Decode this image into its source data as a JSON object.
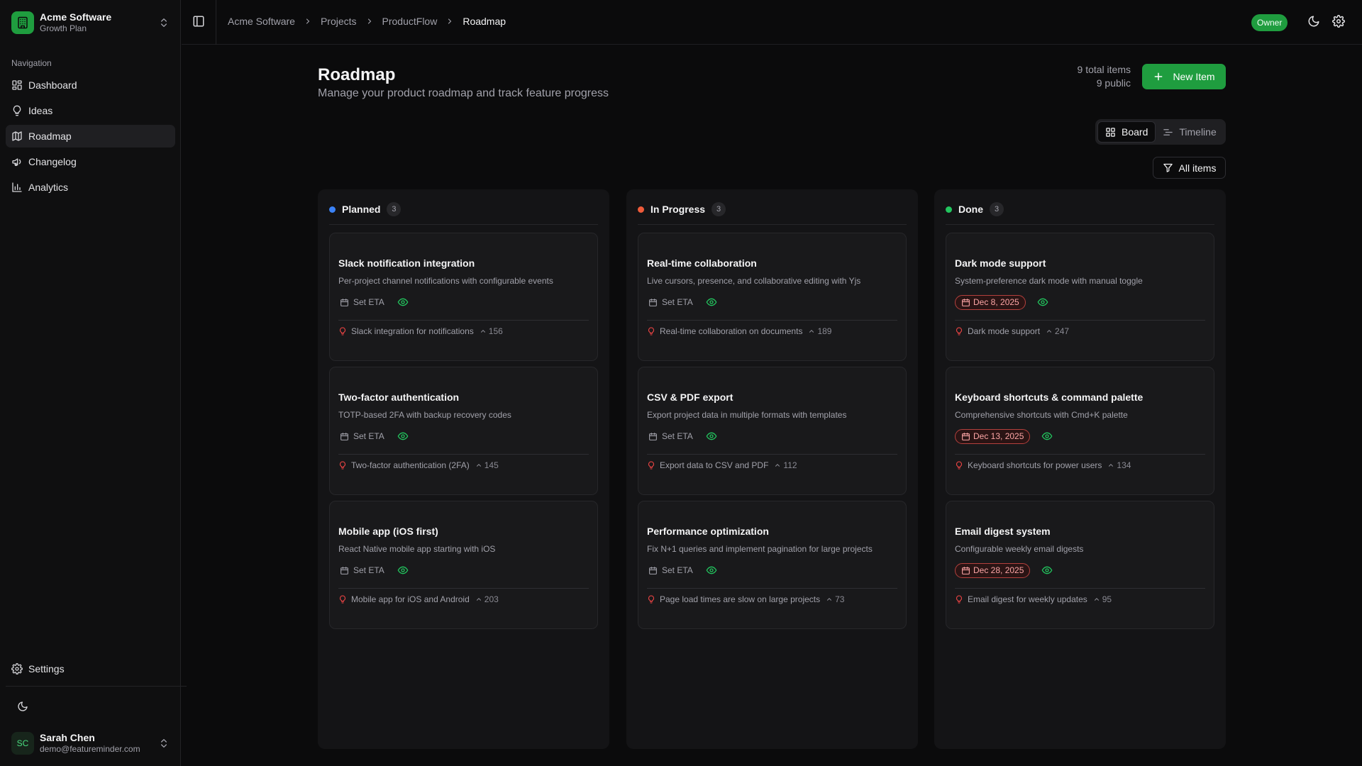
{
  "workspace": {
    "name": "Acme Software",
    "plan": "Growth Plan"
  },
  "nav": {
    "label": "Navigation",
    "items": [
      {
        "label": "Dashboard",
        "icon": "dashboard-icon"
      },
      {
        "label": "Ideas",
        "icon": "lightbulb-icon"
      },
      {
        "label": "Roadmap",
        "icon": "map-icon",
        "active": true
      },
      {
        "label": "Changelog",
        "icon": "megaphone-icon"
      },
      {
        "label": "Analytics",
        "icon": "bar-chart-icon"
      }
    ],
    "settings": "Settings"
  },
  "user": {
    "initials": "SC",
    "name": "Sarah Chen",
    "email": "demo@featureminder.com"
  },
  "breadcrumb": [
    "Acme Software",
    "Projects",
    "ProductFlow",
    "Roadmap"
  ],
  "header": {
    "role_badge": "Owner"
  },
  "page": {
    "title": "Roadmap",
    "subtitle": "Manage your product roadmap and track feature progress",
    "total_items": "9 total items",
    "public_items": "9 public",
    "new_button": "New Item"
  },
  "view_toggle": {
    "board": "Board",
    "timeline": "Timeline",
    "active": "board"
  },
  "filter": {
    "label": "All items"
  },
  "colors": {
    "accent": "#1f9d3f",
    "planned": "#3b82f6",
    "in_progress": "#ef5b3a",
    "done": "#22c55e",
    "eta_overdue": "#ef4444"
  },
  "columns": [
    {
      "title": "Planned",
      "count": "3",
      "status": "planned",
      "cards": [
        {
          "title": "Slack notification integration",
          "description": "Per-project channel notifications with configurable events",
          "eta": "Set ETA",
          "eta_set": false,
          "idea": "Slack integration for notifications",
          "votes": "156"
        },
        {
          "title": "Two-factor authentication",
          "description": "TOTP-based 2FA with backup recovery codes",
          "eta": "Set ETA",
          "eta_set": false,
          "idea": "Two-factor authentication (2FA)",
          "votes": "145"
        },
        {
          "title": "Mobile app (iOS first)",
          "description": "React Native mobile app starting with iOS",
          "eta": "Set ETA",
          "eta_set": false,
          "idea": "Mobile app for iOS and Android",
          "votes": "203"
        }
      ]
    },
    {
      "title": "In Progress",
      "count": "3",
      "status": "in_progress",
      "cards": [
        {
          "title": "Real-time collaboration",
          "description": "Live cursors, presence, and collaborative editing with Yjs",
          "eta": "Set ETA",
          "eta_set": false,
          "idea": "Real-time collaboration on documents",
          "votes": "189"
        },
        {
          "title": "CSV & PDF export",
          "description": "Export project data in multiple formats with templates",
          "eta": "Set ETA",
          "eta_set": false,
          "idea": "Export data to CSV and PDF",
          "votes": "112"
        },
        {
          "title": "Performance optimization",
          "description": "Fix N+1 queries and implement pagination for large projects",
          "eta": "Set ETA",
          "eta_set": false,
          "idea": "Page load times are slow on large projects",
          "votes": "73"
        }
      ]
    },
    {
      "title": "Done",
      "count": "3",
      "status": "done",
      "cards": [
        {
          "title": "Dark mode support",
          "description": "System-preference dark mode with manual toggle",
          "eta": "Dec 8, 2025",
          "eta_set": true,
          "idea": "Dark mode support",
          "votes": "247"
        },
        {
          "title": "Keyboard shortcuts & command palette",
          "description": "Comprehensive shortcuts with Cmd+K palette",
          "eta": "Dec 13, 2025",
          "eta_set": true,
          "idea": "Keyboard shortcuts for power users",
          "votes": "134"
        },
        {
          "title": "Email digest system",
          "description": "Configurable weekly email digests",
          "eta": "Dec 28, 2025",
          "eta_set": true,
          "idea": "Email digest for weekly updates",
          "votes": "95"
        }
      ]
    }
  ]
}
